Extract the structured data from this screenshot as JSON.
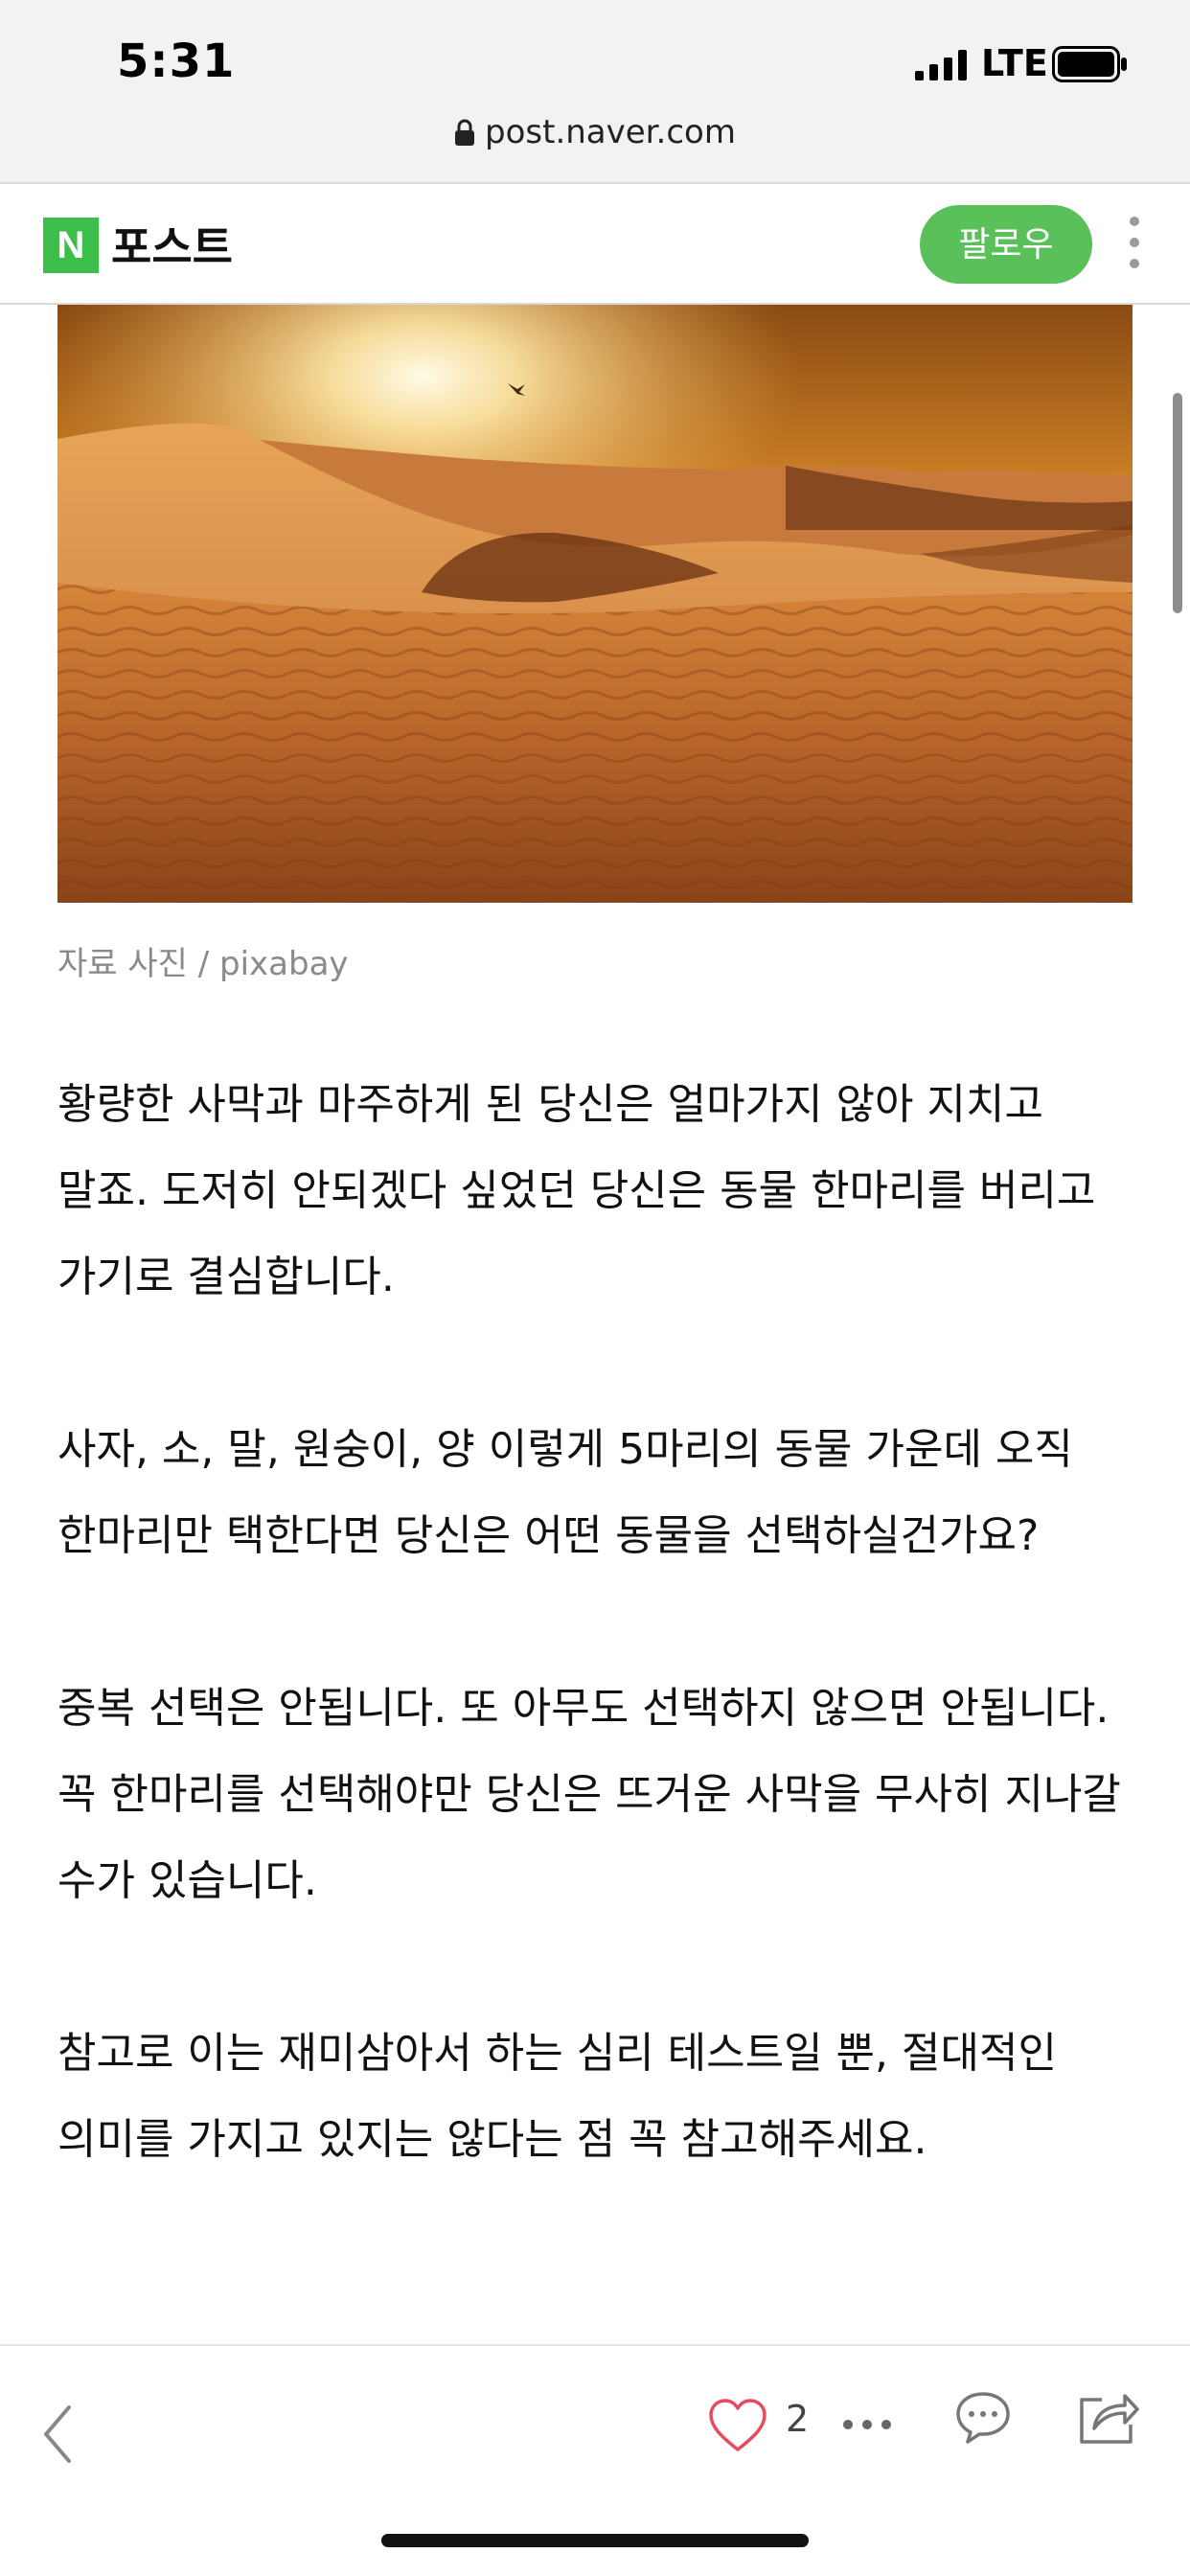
{
  "status_bar": {
    "time": "5:31",
    "network": "LTE"
  },
  "browser": {
    "url": "post.naver.com"
  },
  "header": {
    "logo_letter": "N",
    "service_name": "포스트",
    "follow_label": "팔로우"
  },
  "article": {
    "image_caption": "자료 사진 / pixabay",
    "paragraphs": [
      "황량한 사막과 마주하게 된 당신은 얼마가지 않아 지치고 말죠. 도저히 안되겠다 싶었던 당신은 동물 한마리를 버리고 가기로 결심합니다.",
      "사자, 소, 말, 원숭이, 양 이렇게 5마리의 동물 가운데 오직 한마리만 택한다면 당신은 어떤 동물을 선택하실건가요?",
      "중복 선택은 안됩니다. 또 아무도 선택하지 않으면 안됩니다. 꼭 한마리를 선택해야만 당신은 뜨거운 사막을 무사히 지나갈 수가 있습니다.",
      "참고로 이는 재미삼아서 하는 심리 테스트일 뿐, 절대적인 의미를 가지고 있지는 않다는 점 꼭 참고해주세요."
    ]
  },
  "toolbar": {
    "like_count": "2",
    "icons": [
      "back-icon",
      "heart-icon",
      "more-dots-icon",
      "comment-icon",
      "share-icon"
    ]
  },
  "colors": {
    "naver_green": "#3dbd4a",
    "follow_green": "#5ac05a",
    "heart_red": "#e84a5f"
  }
}
